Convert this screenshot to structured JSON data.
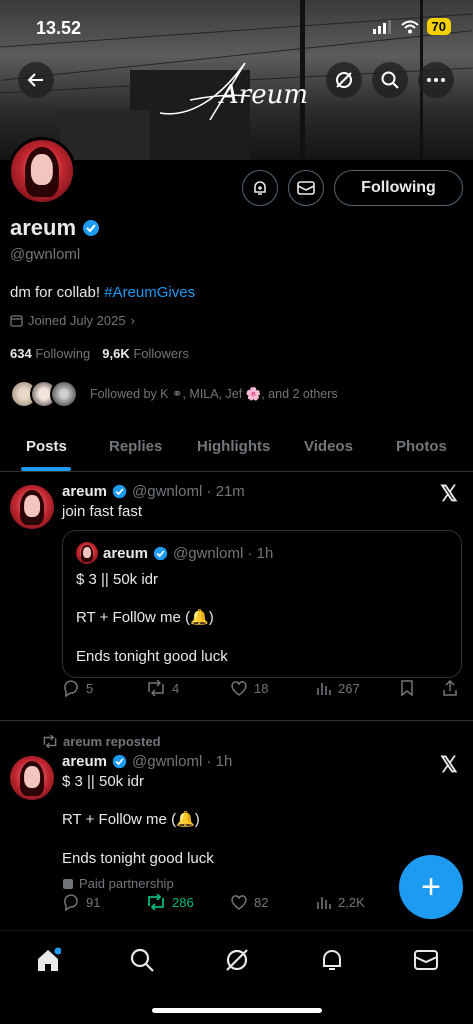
{
  "status_bar": {
    "time": "13.52",
    "battery": "70"
  },
  "banner": {
    "logo_text": "Areum"
  },
  "profile": {
    "name": "areum",
    "handle": "@gwnloml",
    "bio_text": "dm for collab! ",
    "bio_hashtag": "#AreumGives",
    "joined": "Joined July 2025",
    "following_count": "634",
    "following_label": "Following",
    "followers_count": "9,6K",
    "followers_label": "Followers",
    "followed_by": "Followed by K ⚭, MILA, Jef 🌸, and 2 others",
    "follow_button": "Following"
  },
  "tabs": [
    {
      "label": "Posts"
    },
    {
      "label": "Replies"
    },
    {
      "label": "Highlights"
    },
    {
      "label": "Videos"
    },
    {
      "label": "Photos"
    }
  ],
  "post1": {
    "name": "areum",
    "handle": "@gwnloml · 21m",
    "text": "join fast fast",
    "quote": {
      "name": "areum",
      "handle": "@gwnloml · 1h",
      "line1": "$ 3 || 50k idr",
      "line2": "RT + Foll0w me (🔔)",
      "line3": "Ends tonight good luck"
    },
    "replies": "5",
    "reposts": "4",
    "likes": "18",
    "views": "267"
  },
  "post2": {
    "repost_label": "areum reposted",
    "name": "areum",
    "handle": "@gwnloml · 1h",
    "line1": "$ 3 || 50k idr",
    "line2": "RT + Foll0w me (🔔)",
    "line3": "Ends tonight good luck",
    "paid": "Paid partnership",
    "replies": "91",
    "reposts": "286",
    "likes": "82",
    "views": "2,2K"
  },
  "colors": {
    "accent": "#1d9bf0",
    "repost_green": "#00ba7c",
    "muted": "#71767b"
  }
}
